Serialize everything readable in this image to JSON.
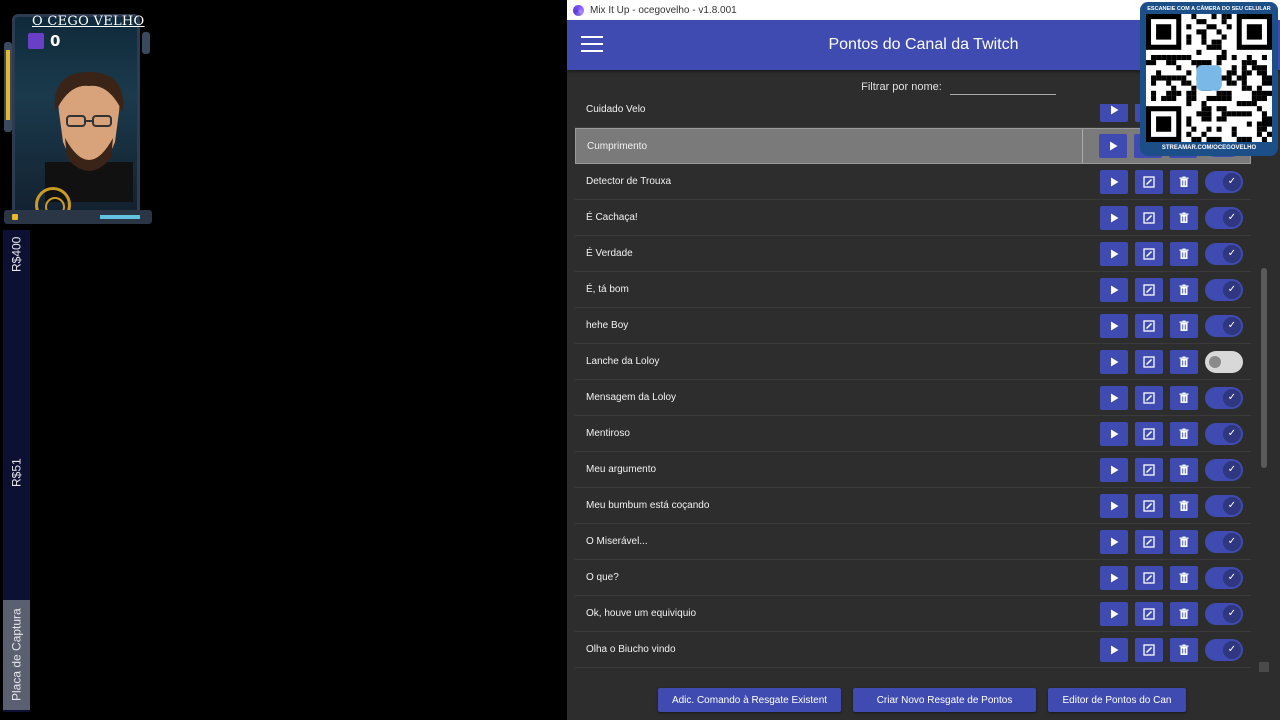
{
  "streamer": {
    "name": "O CEGO VELHO",
    "counter": "0"
  },
  "side_strip": {
    "label_1": "R$400",
    "label_2": "R$51",
    "label_3": "Placa de Captura"
  },
  "window": {
    "title": "Mix It Up - ocegovelho - v1.8.001"
  },
  "appbar": {
    "title": "Pontos do Canal da Twitch"
  },
  "filter": {
    "label": "Filtrar por nome:",
    "value": ""
  },
  "rows": [
    {
      "name": "Cuidado Velo",
      "enabled": true
    },
    {
      "name": "Cumprimento",
      "enabled": true,
      "selected": true
    },
    {
      "name": "Detector de Trouxa",
      "enabled": true
    },
    {
      "name": "É Cachaça!",
      "enabled": true
    },
    {
      "name": "É Verdade",
      "enabled": true
    },
    {
      "name": "É, tá bom",
      "enabled": true
    },
    {
      "name": "hehe Boy",
      "enabled": true
    },
    {
      "name": "Lanche da Loloy",
      "enabled": false
    },
    {
      "name": "Mensagem da Loloy",
      "enabled": true
    },
    {
      "name": "Mentiroso",
      "enabled": true
    },
    {
      "name": "Meu argumento",
      "enabled": true
    },
    {
      "name": "Meu bumbum está coçando",
      "enabled": true
    },
    {
      "name": "O Miserável...",
      "enabled": true
    },
    {
      "name": "O que?",
      "enabled": true
    },
    {
      "name": "Ok, houve um equiviquio",
      "enabled": true
    },
    {
      "name": "Olha o Biucho vindo",
      "enabled": true
    },
    {
      "name": "",
      "enabled": true
    }
  ],
  "bottom_buttons": [
    {
      "label": "Adic. Comando à Resgate Existent"
    },
    {
      "label": "Criar Novo Resgate de Pontos"
    },
    {
      "label": "Editor de Pontos do Can"
    }
  ],
  "qr": {
    "top_text": "ESCANEIE COM A CÂMERA DO SEU CELULAR",
    "bottom_text": "STREAMAR.COM/OCEGOVELHO"
  },
  "colors": {
    "accent": "#3f4bb0",
    "background": "#2d2d2d",
    "qr_bg": "#1c4e87"
  },
  "icons": {
    "row_actions": [
      "play-icon",
      "edit-icon",
      "trash-icon"
    ],
    "toggle_on": "check-icon"
  }
}
